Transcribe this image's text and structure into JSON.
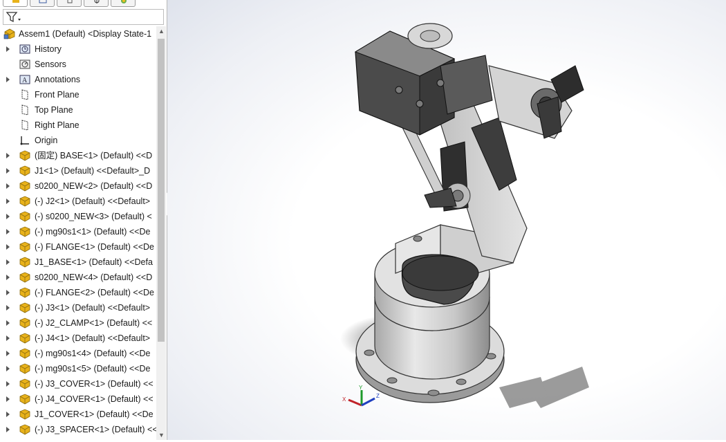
{
  "tree": {
    "root": "Assem1 (Default) <Display State-1",
    "items": [
      {
        "label": "History",
        "expandable": true,
        "icon": "history-icon"
      },
      {
        "label": "Sensors",
        "expandable": false,
        "icon": "sensors-icon"
      },
      {
        "label": "Annotations",
        "expandable": true,
        "icon": "annotations-icon"
      },
      {
        "label": "Front Plane",
        "expandable": false,
        "icon": "plane-icon"
      },
      {
        "label": "Top Plane",
        "expandable": false,
        "icon": "plane-icon"
      },
      {
        "label": "Right Plane",
        "expandable": false,
        "icon": "plane-icon"
      },
      {
        "label": "Origin",
        "expandable": false,
        "icon": "origin-icon"
      },
      {
        "label": "(固定) BASE<1> (Default) <<D",
        "expandable": true,
        "icon": "part-icon"
      },
      {
        "label": "J1<1> (Default) <<Default>_D",
        "expandable": true,
        "icon": "part-icon"
      },
      {
        "label": "s0200_NEW<2> (Default) <<D",
        "expandable": true,
        "icon": "part-icon"
      },
      {
        "label": "(-) J2<1> (Default) <<Default>",
        "expandable": true,
        "icon": "part-icon"
      },
      {
        "label": "(-) s0200_NEW<3> (Default) <",
        "expandable": true,
        "icon": "part-icon"
      },
      {
        "label": "(-) mg90s1<1> (Default) <<De",
        "expandable": true,
        "icon": "part-icon"
      },
      {
        "label": "(-) FLANGE<1> (Default) <<De",
        "expandable": true,
        "icon": "part-icon"
      },
      {
        "label": "J1_BASE<1> (Default) <<Defa",
        "expandable": true,
        "icon": "part-icon"
      },
      {
        "label": "s0200_NEW<4> (Default) <<D",
        "expandable": true,
        "icon": "part-icon"
      },
      {
        "label": "(-) FLANGE<2> (Default) <<De",
        "expandable": true,
        "icon": "part-icon"
      },
      {
        "label": "(-) J3<1> (Default) <<Default>",
        "expandable": true,
        "icon": "part-icon"
      },
      {
        "label": "(-) J2_CLAMP<1> (Default) <<",
        "expandable": true,
        "icon": "part-icon"
      },
      {
        "label": "(-) J4<1> (Default) <<Default>",
        "expandable": true,
        "icon": "part-icon"
      },
      {
        "label": "(-) mg90s1<4> (Default) <<De",
        "expandable": true,
        "icon": "part-icon"
      },
      {
        "label": "(-) mg90s1<5> (Default) <<De",
        "expandable": true,
        "icon": "part-icon"
      },
      {
        "label": "(-) J3_COVER<1> (Default) <<",
        "expandable": true,
        "icon": "part-icon"
      },
      {
        "label": "(-) J4_COVER<1> (Default) <<",
        "expandable": true,
        "icon": "part-icon"
      },
      {
        "label": "J1_COVER<1> (Default) <<De",
        "expandable": true,
        "icon": "part-icon"
      },
      {
        "label": "(-) J3_SPACER<1> (Default) <<",
        "expandable": true,
        "icon": "part-icon"
      }
    ]
  },
  "triad": {
    "x": "X",
    "y": "Y",
    "z": "Z"
  },
  "colors": {
    "x_axis": "#c0232a",
    "y_axis": "#1e9a2a",
    "z_axis": "#2040c0",
    "part_icon": "#e8b21a"
  }
}
